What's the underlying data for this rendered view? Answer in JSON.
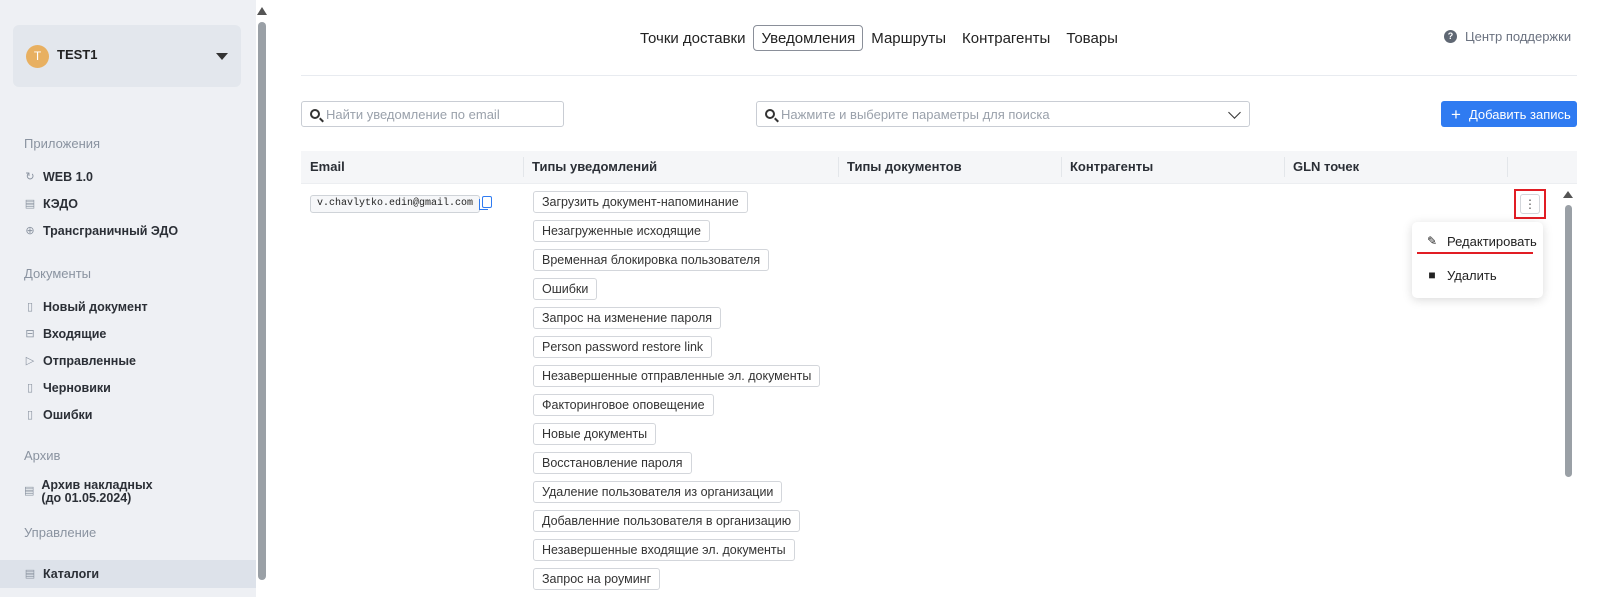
{
  "org": {
    "avatar_letter": "T",
    "name": "TEST1"
  },
  "sidebar": {
    "sections": [
      {
        "title": "Приложения",
        "items": [
          {
            "icon": "refresh-icon",
            "label": "WEB 1.0"
          },
          {
            "icon": "document-icon",
            "label": "КЭДО"
          },
          {
            "icon": "globe-icon",
            "label": "Трансграничный ЭДО"
          }
        ]
      },
      {
        "title": "Документы",
        "items": [
          {
            "icon": "new-document-icon",
            "label": "Новый документ"
          },
          {
            "icon": "inbox-icon",
            "label": "Входящие"
          },
          {
            "icon": "send-icon",
            "label": "Отправленные"
          },
          {
            "icon": "draft-icon",
            "label": "Черновики"
          },
          {
            "icon": "error-document-icon",
            "label": "Ошибки"
          }
        ]
      },
      {
        "title": "Архив",
        "items": [
          {
            "icon": "archive-icon",
            "label": "Архив накладных (до 01.05.2024)"
          }
        ]
      },
      {
        "title": "Управление",
        "items": [
          {
            "icon": "catalog-icon",
            "label": "Каталоги",
            "active": true
          }
        ]
      }
    ]
  },
  "topnav": {
    "tabs": [
      "Точки доставки",
      "Уведомления",
      "Маршруты",
      "Контрагенты",
      "Товары"
    ],
    "active_tab": "Уведомления",
    "support_label": "Центр поддержки"
  },
  "filters": {
    "email_placeholder": "Найти уведомление по email",
    "params_placeholder": "Нажмите и выберите параметры для поиска",
    "add_button_label": "Добавить запись"
  },
  "table": {
    "columns": [
      "Email",
      "Типы уведомлений",
      "Типы документов",
      "Контрагенты",
      "GLN точек"
    ],
    "rows": [
      {
        "email": "v.chavlytko.edin@gmail.com",
        "notification_types": [
          "Загрузить документ-напоминание",
          "Незагруженные исходящие",
          "Временная блокировка пользователя",
          "Ошибки",
          "Запрос на изменение пароля",
          "Person password restore link",
          "Незавершенные отправленные эл. документы",
          "Факторинговое оповещение",
          "Новые документы",
          "Восстановление пароля",
          "Удаление пользователя из организации",
          "Добавленние пользователя в организацию",
          "Незавершенные входящие эл. документы",
          "Запрос на роуминг"
        ]
      }
    ]
  },
  "row_menu": {
    "items": [
      {
        "icon": "pencil-icon",
        "label": "Редактировать"
      },
      {
        "icon": "trash-icon",
        "label": "Удалить"
      }
    ]
  },
  "colors": {
    "accent": "#2f7bf1",
    "highlight": "#e11d24",
    "sidebar_bg": "#eef0f4",
    "avatar": "#e8b061"
  }
}
